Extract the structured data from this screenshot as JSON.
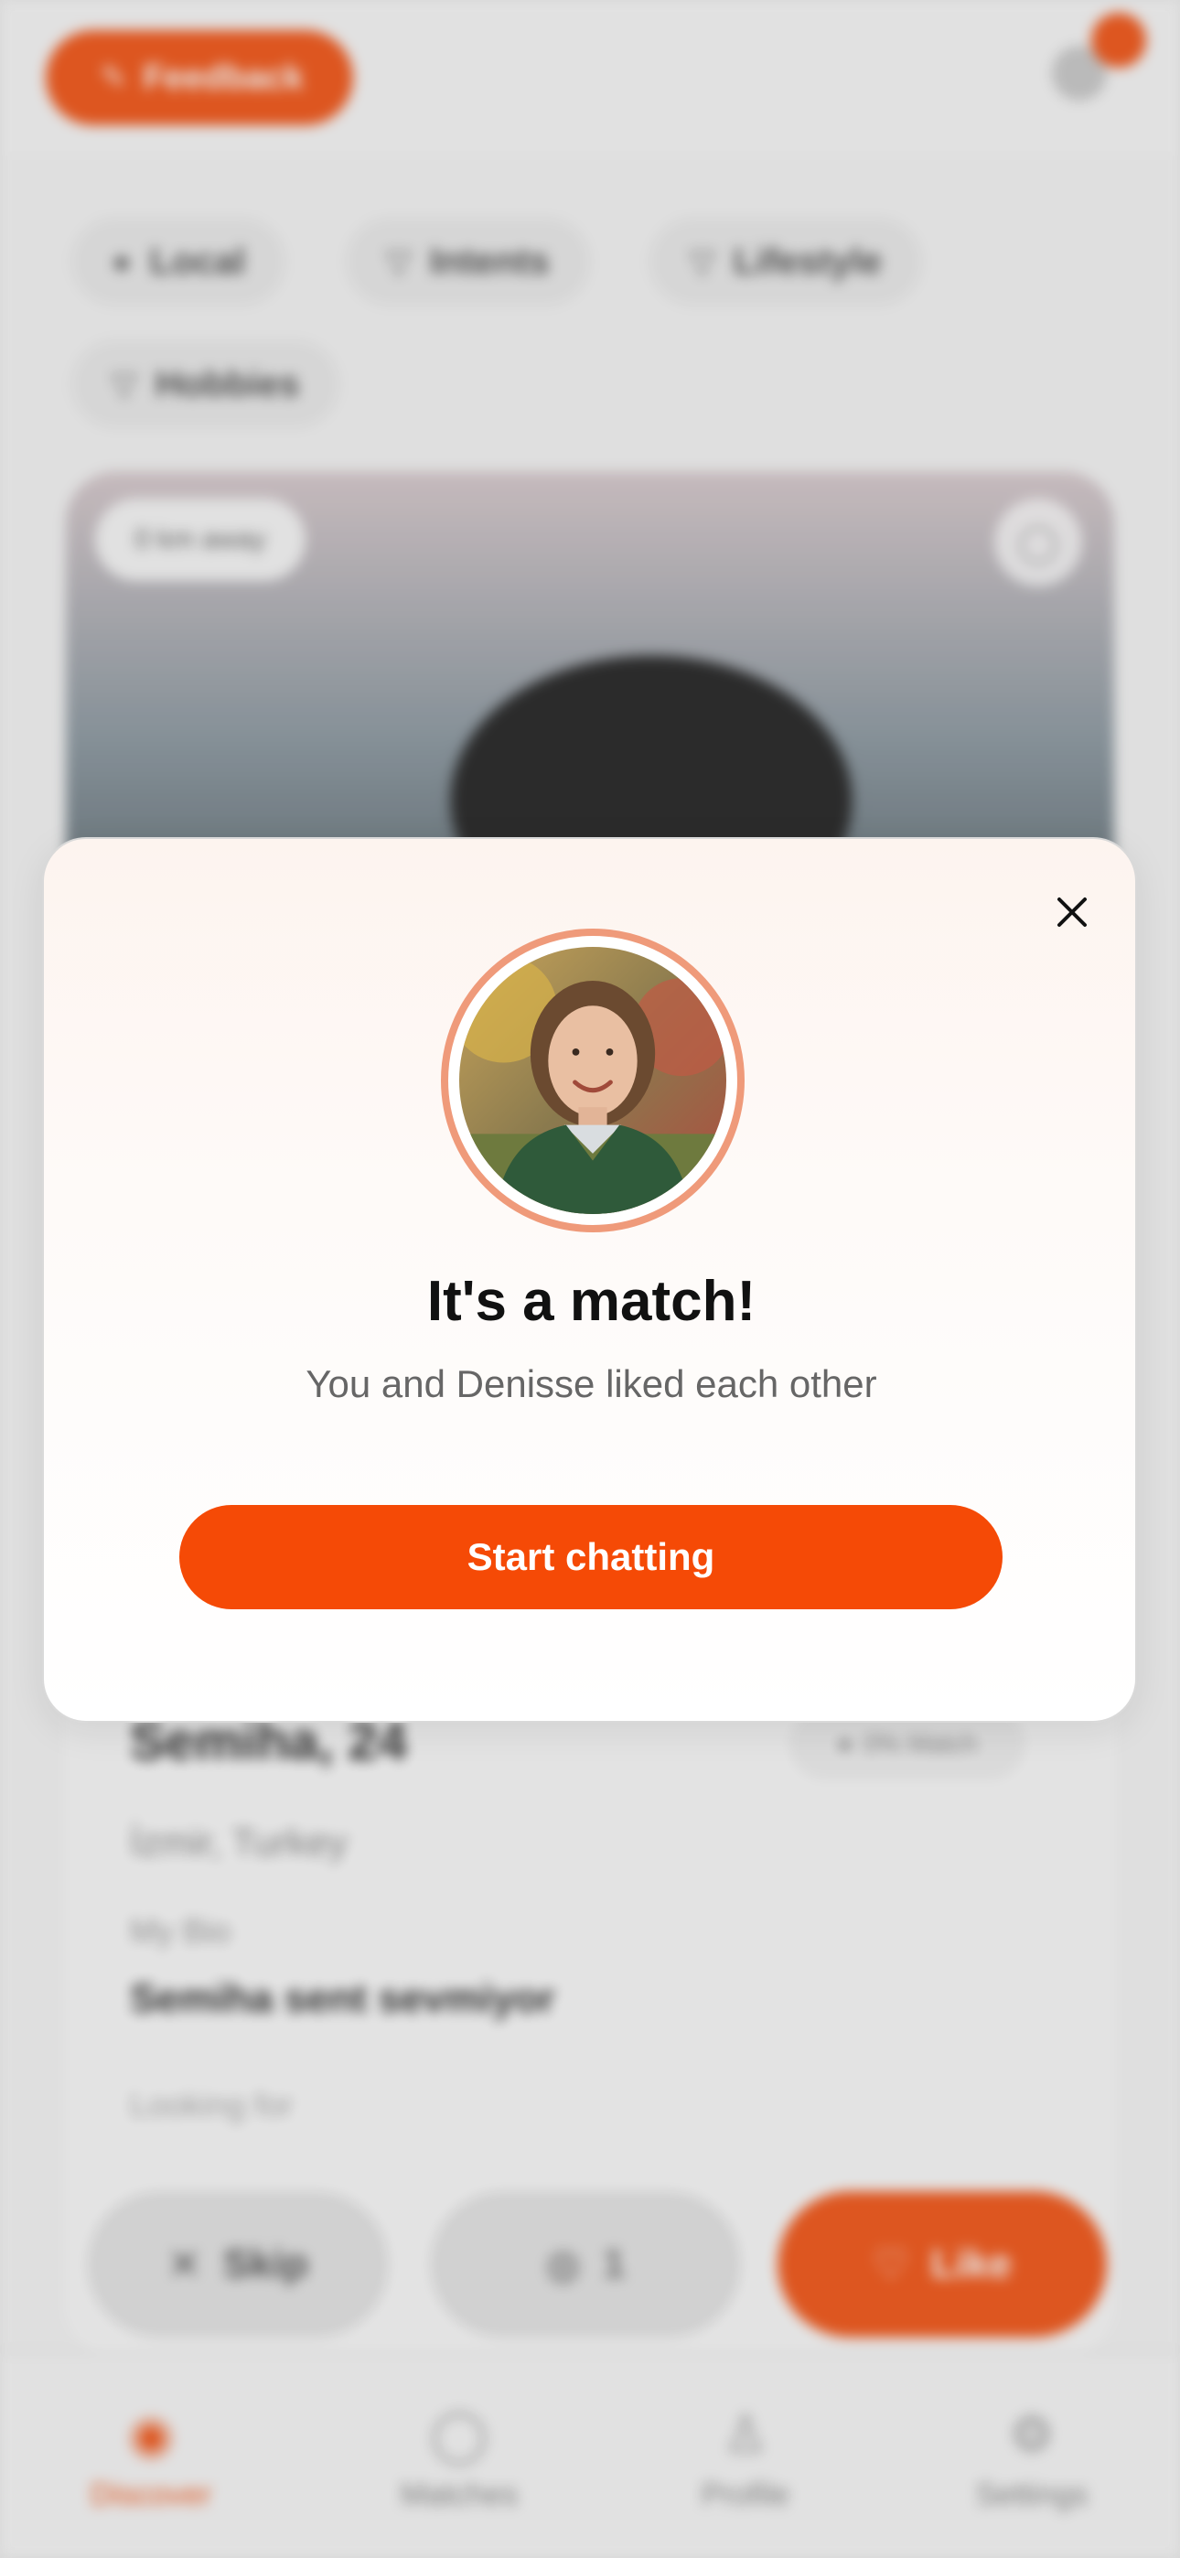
{
  "header": {
    "feedback_label": "Feedback",
    "feedback_icon": "edit-icon",
    "notification_icon": "bell-icon"
  },
  "filters": [
    {
      "label": "Local",
      "icon": "pin-icon"
    },
    {
      "label": "Intents",
      "icon": "filter-icon"
    },
    {
      "label": "Lifestyle",
      "icon": "filter-icon"
    },
    {
      "label": "Hobbies",
      "icon": "filter-icon"
    }
  ],
  "card": {
    "distance_label": "0 km away",
    "name": "Semiha, 24",
    "match_label": "0% Match",
    "location": "İzmir, Turkey",
    "bio_label": "My Bio",
    "bio_text": "Semiha sent sevmiyor",
    "looking_for_label": "Looking for"
  },
  "actions": {
    "skip_label": "Skip",
    "mid_label": "1",
    "like_label": "Like"
  },
  "tabbar": [
    {
      "label": "Discover",
      "icon": "compass-icon",
      "active": true
    },
    {
      "label": "Matches",
      "icon": "chat-icon",
      "active": false
    },
    {
      "label": "Profile",
      "icon": "person-icon",
      "active": false
    },
    {
      "label": "Settings",
      "icon": "gear-icon",
      "active": false
    }
  ],
  "modal": {
    "title": "It's a match!",
    "subtitle": "You and Denisse liked each other",
    "cta_label": "Start chatting",
    "close_icon": "close-icon",
    "avatar": "avatar-photo"
  },
  "colors": {
    "accent": "#f54a06",
    "ring": "#ef9a7a",
    "title": "#111111",
    "subtitle": "#666666"
  }
}
